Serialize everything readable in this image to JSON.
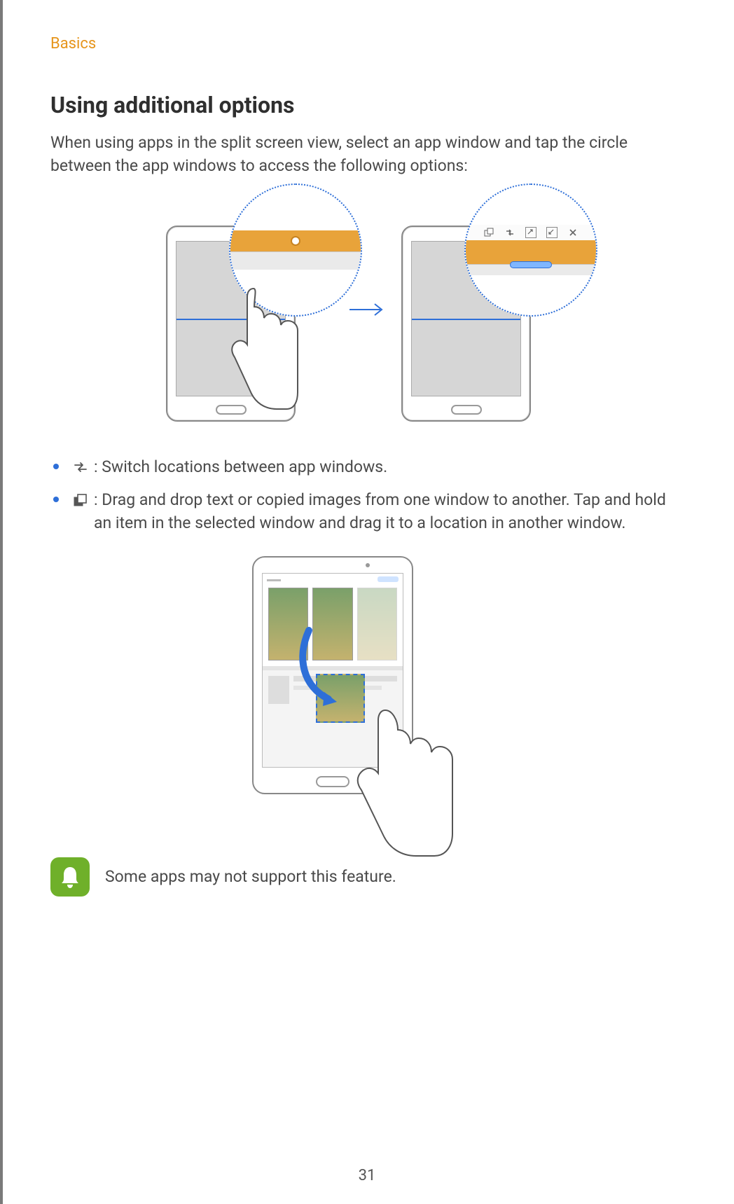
{
  "breadcrumb": "Basics",
  "heading": "Using additional options",
  "intro": "When using apps in the split screen view, select an app window and tap the circle between the app windows to access the following options:",
  "options": [
    {
      "icon_name": "swap-icon",
      "text": ": Switch locations between app windows."
    },
    {
      "icon_name": "drag-content-icon",
      "text": ": Drag and drop text or copied images from one window to another. Tap and hold an item in the selected window and drag it to a location in another window."
    }
  ],
  "zoom_toolbar_icons": [
    "drag-content-icon",
    "swap-icon",
    "expand-icon",
    "minimize-icon",
    "close-icon"
  ],
  "note": "Some apps may not support this feature.",
  "page_number": "31"
}
